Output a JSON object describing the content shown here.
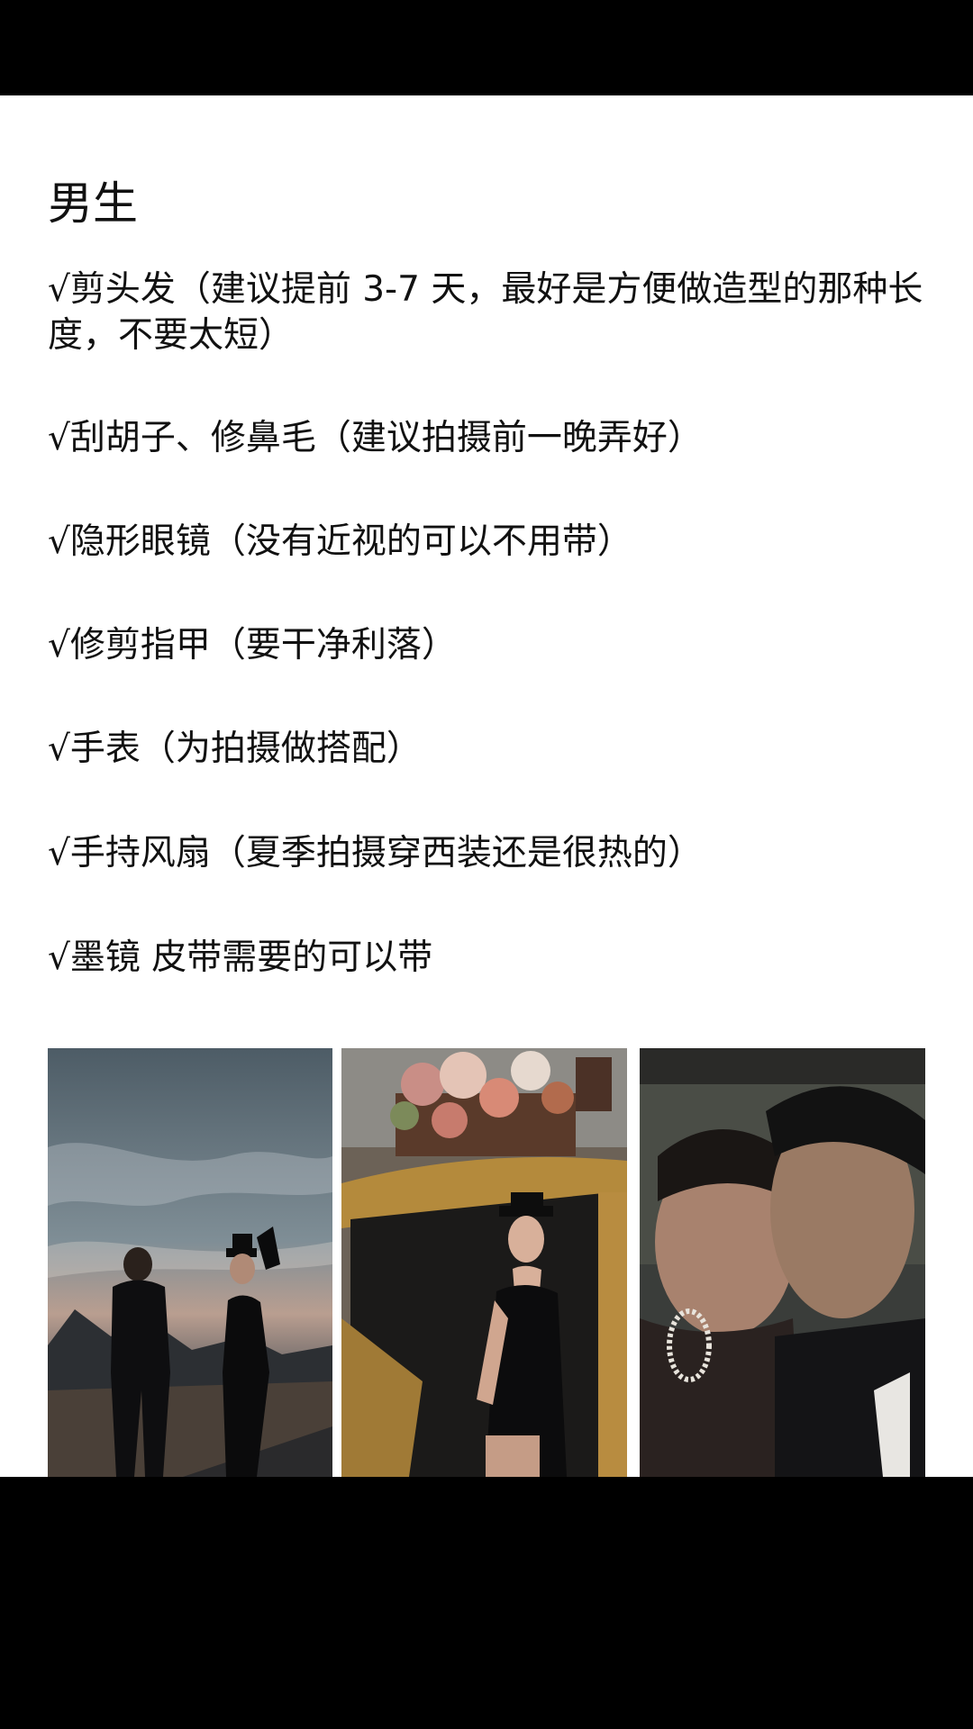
{
  "article": {
    "heading": "男生",
    "items": [
      "√剪头发（建议提前 3-7 天，最好是方便做造型的那种长度，不要太短）",
      "√刮胡子、修鼻毛（建议拍摄前一晚弄好）",
      "√隐形眼镜（没有近视的可以不用带）",
      "√修剪指甲（要干净利落）",
      "√手表（为拍摄做搭配）",
      "√手持风扇（夏季拍摄穿西装还是很热的）",
      "√墨镜 皮带需要的可以带"
    ]
  },
  "photos": [
    {
      "name": "couple-walking-road-photo"
    },
    {
      "name": "woman-in-yellow-car-photo"
    },
    {
      "name": "couple-closeup-photo"
    }
  ],
  "colors": {
    "background": "#000000",
    "content": "#ffffff",
    "text": "#111111"
  }
}
